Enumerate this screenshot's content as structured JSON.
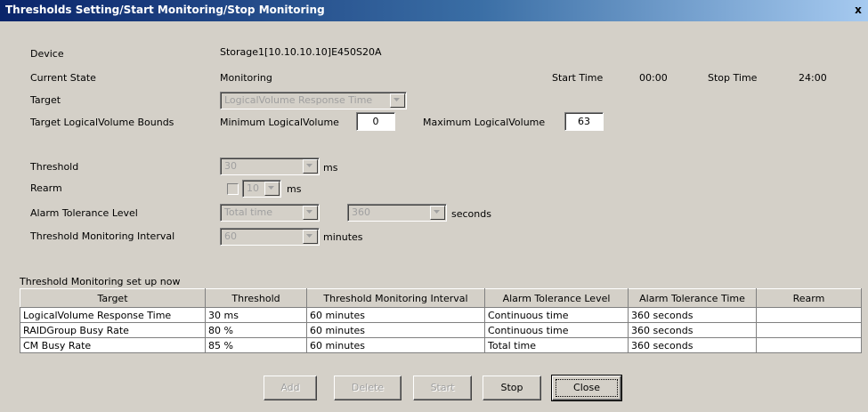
{
  "window": {
    "title": "Thresholds Setting/Start Monitoring/Stop Monitoring",
    "close_glyph": "x"
  },
  "info": {
    "device_label": "Device",
    "device_value": "Storage1[10.10.10.10]E450S20A",
    "current_state_label": "Current State",
    "current_state_value": "Monitoring",
    "start_time_label": "Start Time",
    "start_time_value": "00:00",
    "stop_time_label": "Stop Time",
    "stop_time_value": "24:00",
    "target_label": "Target",
    "target_value": "LogicalVolume Response Time",
    "bounds_label": "Target LogicalVolume Bounds",
    "min_label": "Minimum LogicalVolume",
    "min_value": "0",
    "max_label": "Maximum LogicalVolume",
    "max_value": "63"
  },
  "settings": {
    "threshold_label": "Threshold",
    "threshold_value": "30",
    "threshold_unit": "ms",
    "rearm_label": "Rearm",
    "rearm_value": "10",
    "rearm_unit": "ms",
    "alarm_label": "Alarm Tolerance Level",
    "alarm_value": "Total time",
    "alarm_seconds_value": "360",
    "alarm_seconds_unit": "seconds",
    "interval_label": "Threshold Monitoring Interval",
    "interval_value": "60",
    "interval_unit": "minutes"
  },
  "table": {
    "caption": "Threshold Monitoring set up now",
    "headers": [
      "Target",
      "Threshold",
      "Threshold Monitoring Interval",
      "Alarm Tolerance Level",
      "Alarm Tolerance Time",
      "Rearm"
    ],
    "rows": [
      [
        "LogicalVolume Response Time",
        "30 ms",
        "60 minutes",
        "Continuous time",
        "360 seconds",
        ""
      ],
      [
        "RAIDGroup Busy Rate",
        "80 %",
        "60 minutes",
        "Continuous time",
        "360 seconds",
        ""
      ],
      [
        "CM Busy Rate",
        "85 %",
        "60 minutes",
        "Total time",
        "360 seconds",
        ""
      ]
    ]
  },
  "buttons": {
    "add": "Add",
    "delete": "Delete",
    "start": "Start",
    "stop": "Stop",
    "close": "Close"
  },
  "colors": {
    "face": "#d4d0c8",
    "title_start": "#0a246a",
    "title_end": "#a6caf0",
    "disabled_text": "#a0a0a0"
  }
}
